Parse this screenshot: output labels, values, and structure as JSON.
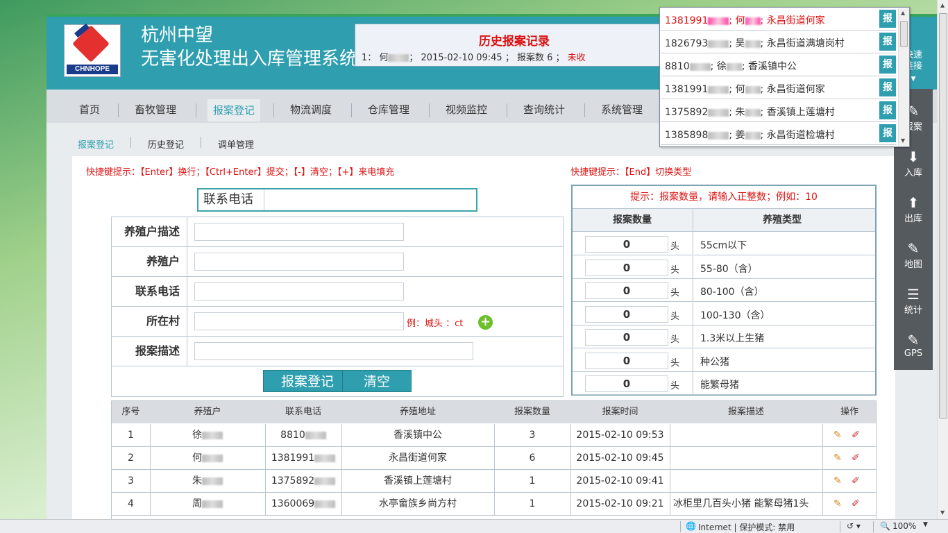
{
  "header": {
    "company": "杭州中望",
    "system": "无害化处理出入库管理系统",
    "logo_text": "CHNHOPE"
  },
  "nav": [
    "首页",
    "畜牧管理",
    "报案登记",
    "物流调度",
    "仓库管理",
    "视频监控",
    "查询统计",
    "系统管理"
  ],
  "subnav": [
    "报案登记",
    "历史登记",
    "调单管理"
  ],
  "hints": {
    "left": "快捷键提示：【Enter】换行；【Ctrl+Enter】提交；【-】清空；【+】来电填充",
    "right": "快捷键提示：【End】切换类型"
  },
  "form": {
    "phone_label": "联系电话",
    "fields": [
      "养殖户描述",
      "养殖户",
      "联系电话",
      "所在村",
      "报案描述"
    ],
    "village_example": "例：城头 ：ct",
    "add_icon": "plus-icon",
    "submit": "报案登记",
    "clear": "清空"
  },
  "count_table": {
    "hint": "提示：报案数量，请输入正整数；例如：10",
    "col_count": "报案数量",
    "col_type": "养殖类型",
    "unit": "头",
    "rows": [
      {
        "value": "0",
        "type": "55cm以下"
      },
      {
        "value": "0",
        "type": "55-80（含）"
      },
      {
        "value": "0",
        "type": "80-100（含）"
      },
      {
        "value": "0",
        "type": "100-130（含）"
      },
      {
        "value": "0",
        "type": "1.3米以上生猪"
      },
      {
        "value": "0",
        "type": "种公猪"
      },
      {
        "value": "0",
        "type": "能繁母猪"
      }
    ]
  },
  "list": {
    "headers": [
      "序号",
      "养殖户",
      "联系电话",
      "养殖地址",
      "报案数量",
      "报案时间",
      "报案描述",
      "操作"
    ],
    "rows": [
      {
        "no": "1",
        "farmer": "徐",
        "phone": "8810",
        "addr": "香溪镇中公",
        "count": "3",
        "time": "2015-02-10 09:53",
        "desc": ""
      },
      {
        "no": "2",
        "farmer": "何",
        "phone": "1381991",
        "addr": "永昌街道何家",
        "count": "6",
        "time": "2015-02-10 09:45",
        "desc": ""
      },
      {
        "no": "3",
        "farmer": "朱",
        "phone": "1375892",
        "addr": "香溪镇上莲塘村",
        "count": "1",
        "time": "2015-02-10 09:41",
        "desc": ""
      },
      {
        "no": "4",
        "farmer": "周",
        "phone": "1360069",
        "addr": "水亭畲族乡尚方村",
        "count": "1",
        "time": "2015-02-10 09:21",
        "desc": "冰柜里几百头小猪 能繁母猪1头"
      }
    ]
  },
  "history_popup": {
    "title": "历史报案记录",
    "line_prefix": "1： 何",
    "line_mid": "； 2015-02-10 09:45 ； 报案数 6 ；",
    "status": "未收"
  },
  "call_popup": {
    "button": "报",
    "rows": [
      {
        "phone": "1381991",
        "name": "何",
        "addr": "永昌街道何家",
        "highlight": true
      },
      {
        "phone": "1826793",
        "name": "吴",
        "addr": "永昌街道满塘岗村",
        "highlight": false
      },
      {
        "phone": "8810",
        "name": "徐",
        "addr": "香溪镇中公",
        "highlight": false
      },
      {
        "phone": "1381991",
        "name": "何",
        "addr": "永昌街道何家",
        "highlight": false
      },
      {
        "phone": "1375892",
        "name": "朱",
        "addr": "香溪镇上莲塘村",
        "highlight": false
      },
      {
        "phone": "1385898",
        "name": "姜",
        "addr": "永昌街道检塘村",
        "highlight": false
      }
    ]
  },
  "sidebar": {
    "quick": "快速链接",
    "items": [
      {
        "label": "报案",
        "icon": "pencil-icon"
      },
      {
        "label": "入库",
        "icon": "box-in-icon"
      },
      {
        "label": "出库",
        "icon": "box-out-icon"
      },
      {
        "label": "地图",
        "icon": "pencil-icon"
      },
      {
        "label": "统计",
        "icon": "document-icon"
      },
      {
        "label": "GPS",
        "icon": "pencil-icon"
      }
    ]
  },
  "statusbar": {
    "zone": "Internet | 保护模式: 禁用",
    "zoom": "100%"
  }
}
